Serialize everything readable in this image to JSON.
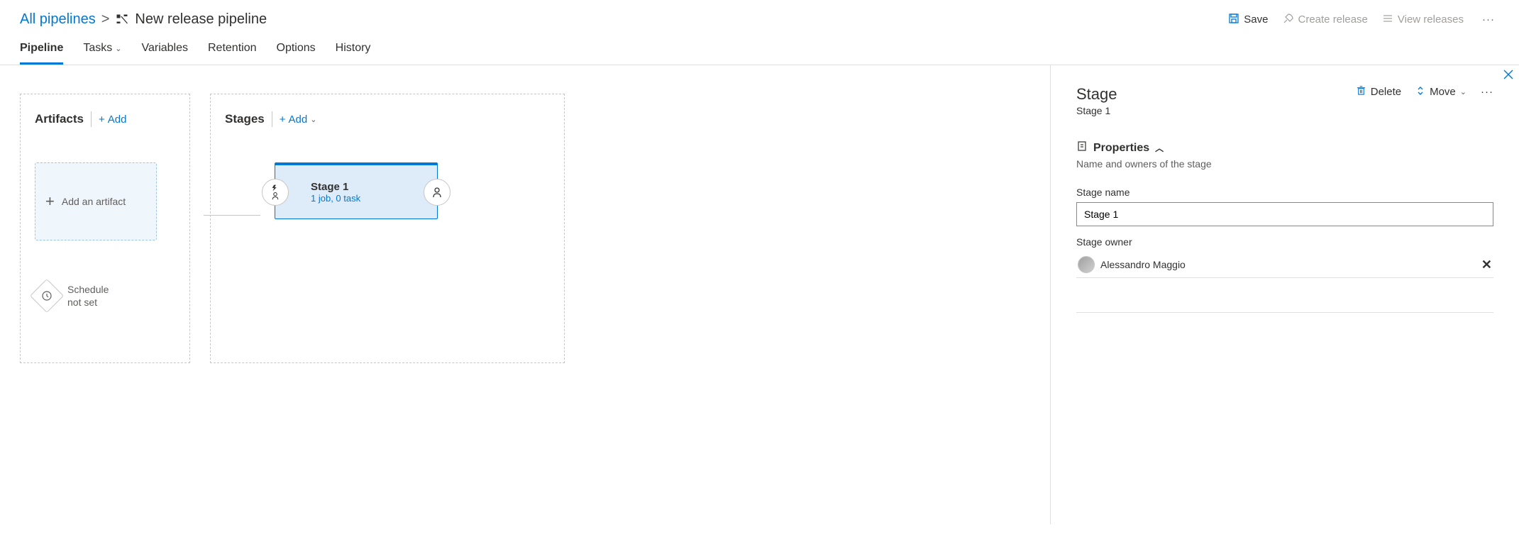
{
  "breadcrumb": {
    "root": "All pipelines",
    "title": "New release pipeline"
  },
  "toolbar": {
    "save": "Save",
    "create_release": "Create release",
    "view_releases": "View releases"
  },
  "tabs": {
    "pipeline": "Pipeline",
    "tasks": "Tasks",
    "variables": "Variables",
    "retention": "Retention",
    "options": "Options",
    "history": "History"
  },
  "artifacts": {
    "title": "Artifacts",
    "add": "Add",
    "placeholder": "Add an artifact",
    "schedule": "Schedule not set"
  },
  "stages": {
    "title": "Stages",
    "add": "Add",
    "card": {
      "name": "Stage 1",
      "sub": "1 job, 0 task"
    }
  },
  "panel": {
    "title": "Stage",
    "subtitle": "Stage 1",
    "actions": {
      "delete": "Delete",
      "move": "Move"
    },
    "properties": {
      "heading": "Properties",
      "desc": "Name and owners of the stage",
      "stage_name_label": "Stage name",
      "stage_name_value": "Stage 1",
      "stage_owner_label": "Stage owner",
      "owner_name": "Alessandro Maggio"
    }
  }
}
